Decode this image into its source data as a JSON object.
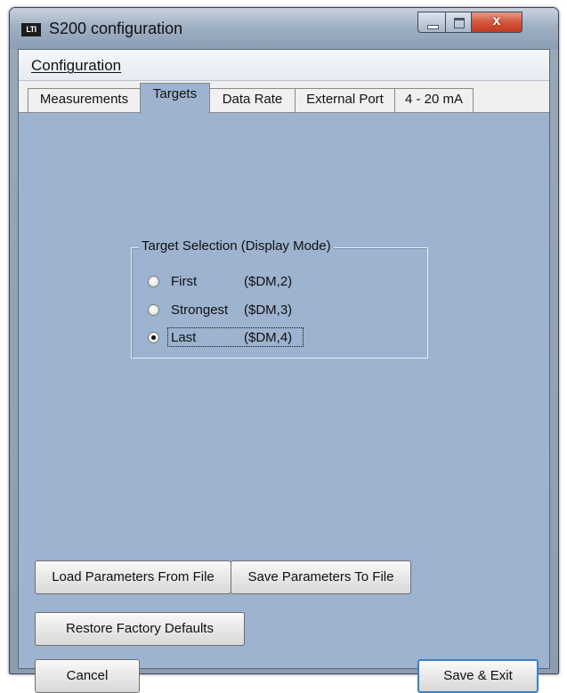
{
  "window": {
    "title": "S200 configuration",
    "icon_text": "LTI",
    "close_glyph": "x"
  },
  "menu": {
    "items": [
      {
        "label": "Configuration"
      }
    ]
  },
  "tabs": [
    {
      "label": "Measurements",
      "active": false
    },
    {
      "label": "Targets",
      "active": true
    },
    {
      "label": "Data Rate",
      "active": false
    },
    {
      "label": "External Port",
      "active": false
    },
    {
      "label": "4 - 20 mA",
      "active": false
    }
  ],
  "target_selection": {
    "legend": "Target Selection (Display Mode)",
    "options": [
      {
        "label": "First",
        "command": "($DM,2)",
        "selected": false
      },
      {
        "label": "Strongest",
        "command": "($DM,3)",
        "selected": false
      },
      {
        "label": "Last",
        "command": "($DM,4)",
        "selected": true
      }
    ]
  },
  "buttons": {
    "load": "Load Parameters From File",
    "save_params": "Save Parameters To File",
    "restore": "Restore Factory Defaults",
    "cancel": "Cancel",
    "save_exit": "Save & Exit"
  },
  "colors": {
    "panel_bg": "#9db3cf",
    "close_button": "#c9432b",
    "default_button_border": "#3b82c4"
  }
}
